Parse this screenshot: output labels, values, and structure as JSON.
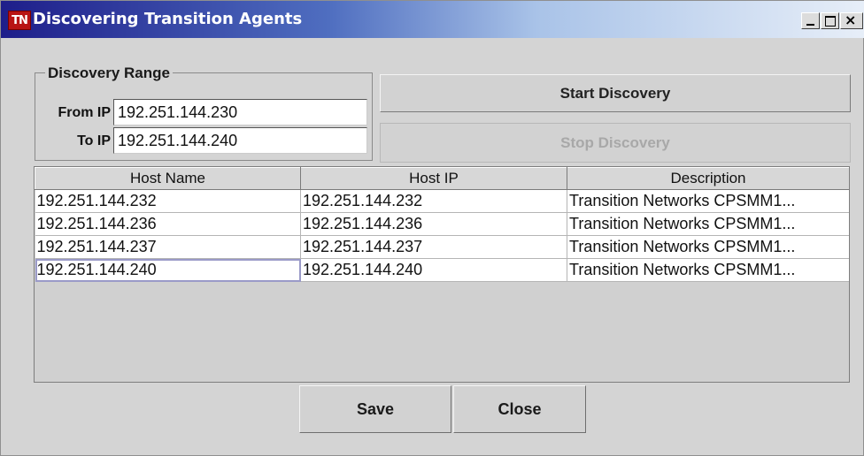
{
  "window": {
    "app_icon": "transition-networks-logo",
    "app_icon_text": "TN",
    "title": "Discovering Transition Agents",
    "controls": {
      "minimize": "minimize-icon",
      "maximize": "maximize-icon",
      "close": "close-icon"
    }
  },
  "discovery_range": {
    "legend": "Discovery Range",
    "from_label": "From IP",
    "from_value": "192.251.144.230",
    "to_label": "To IP",
    "to_value": "192.251.144.240"
  },
  "actions": {
    "start_label": "Start Discovery",
    "stop_label": "Stop Discovery",
    "stop_enabled": false
  },
  "table": {
    "columns": [
      "Host Name",
      "Host IP",
      "Description"
    ],
    "rows": [
      [
        "192.251.144.232",
        "192.251.144.232",
        "Transition Networks CPSMM1..."
      ],
      [
        "192.251.144.236",
        "192.251.144.236",
        "Transition Networks CPSMM1..."
      ],
      [
        "192.251.144.237",
        "192.251.144.237",
        "Transition Networks CPSMM1..."
      ],
      [
        "192.251.144.240",
        "192.251.144.240",
        "Transition Networks CPSMM1..."
      ]
    ],
    "focused_row": 3
  },
  "footer": {
    "save_label": "Save",
    "close_label": "Close"
  },
  "colors": {
    "window_bg": "#d4d4d4",
    "title_start": "#1e1e8a",
    "title_end": "#e7eef8",
    "logo": "#b81414",
    "disabled_text": "#a8a8a8"
  }
}
